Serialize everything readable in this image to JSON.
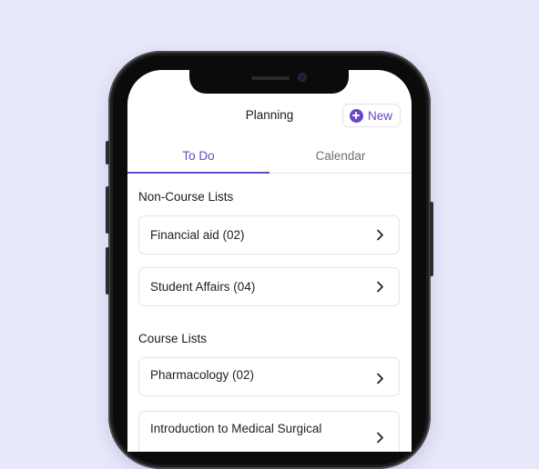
{
  "header": {
    "title": "Planning",
    "new_label": "New"
  },
  "tabs": [
    {
      "label": "To Do",
      "active": true
    },
    {
      "label": "Calendar",
      "active": false
    }
  ],
  "sections": {
    "non_course": {
      "title": "Non-Course Lists",
      "items": [
        {
          "label": "Financial aid (02)"
        },
        {
          "label": "Student Affairs (04)"
        }
      ]
    },
    "course": {
      "title": "Course Lists",
      "items": [
        {
          "label": "Pharmacology (02)"
        },
        {
          "label": "Introduction to Medical Surgical"
        }
      ]
    }
  },
  "colors": {
    "accent": "#6b46c8",
    "background": "#e8e8fb"
  }
}
